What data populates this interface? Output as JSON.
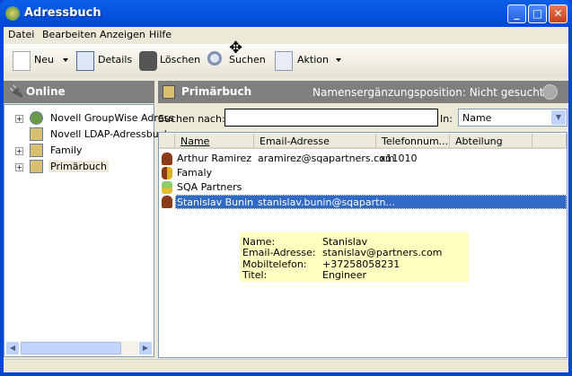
{
  "window": {
    "title": "Adressbuch"
  },
  "menu": [
    "Datei",
    "Bearbeiten",
    "Anzeigen",
    "Hilfe"
  ],
  "toolbar": {
    "new": "Neu",
    "details": "Details",
    "delete": "Löschen",
    "search": "Suchen",
    "action": "Aktion"
  },
  "left": {
    "title": "Online",
    "tree": [
      "Novell GroupWise Adress",
      "Novell LDAP-Adressbuch",
      "Family",
      "Primärbuch"
    ]
  },
  "right": {
    "title": "Primärbuch",
    "status": "Namensergänzungsposition: Nicht gesucht",
    "search_label": "Suchen nach:",
    "search_value": "",
    "in_label": "In:",
    "in_value": "Name",
    "columns": [
      "Name",
      "Email-Adresse",
      "Telefonnum...",
      "Abteilung"
    ],
    "rows": [
      {
        "name": "Arthur Ramirez",
        "email": "aramirez@sqapartners.com",
        "phone": "x11010",
        "dept": "",
        "type": "user"
      },
      {
        "name": "Famaly",
        "email": "",
        "phone": "",
        "dept": "",
        "type": "group"
      },
      {
        "name": "SQA Partners",
        "email": "",
        "phone": "",
        "dept": "",
        "type": "org"
      },
      {
        "name": "Stanislav Bunin",
        "email": "stanislav.bunin@sqapartn...",
        "phone": "",
        "dept": "",
        "type": "user",
        "selected": true
      }
    ]
  },
  "tooltip": [
    {
      "label": "Name:",
      "value": "Stanislav"
    },
    {
      "label": "Email-Adresse:",
      "value": "stanislav@partners.com"
    },
    {
      "label": "Mobiltelefon:",
      "value": "+37258058231"
    },
    {
      "label": "Titel:",
      "value": "Engineer"
    }
  ],
  "colors": {
    "titlebar": "#0a5fe8",
    "selection": "#316ac5",
    "tooltip": "#ffffc0"
  }
}
